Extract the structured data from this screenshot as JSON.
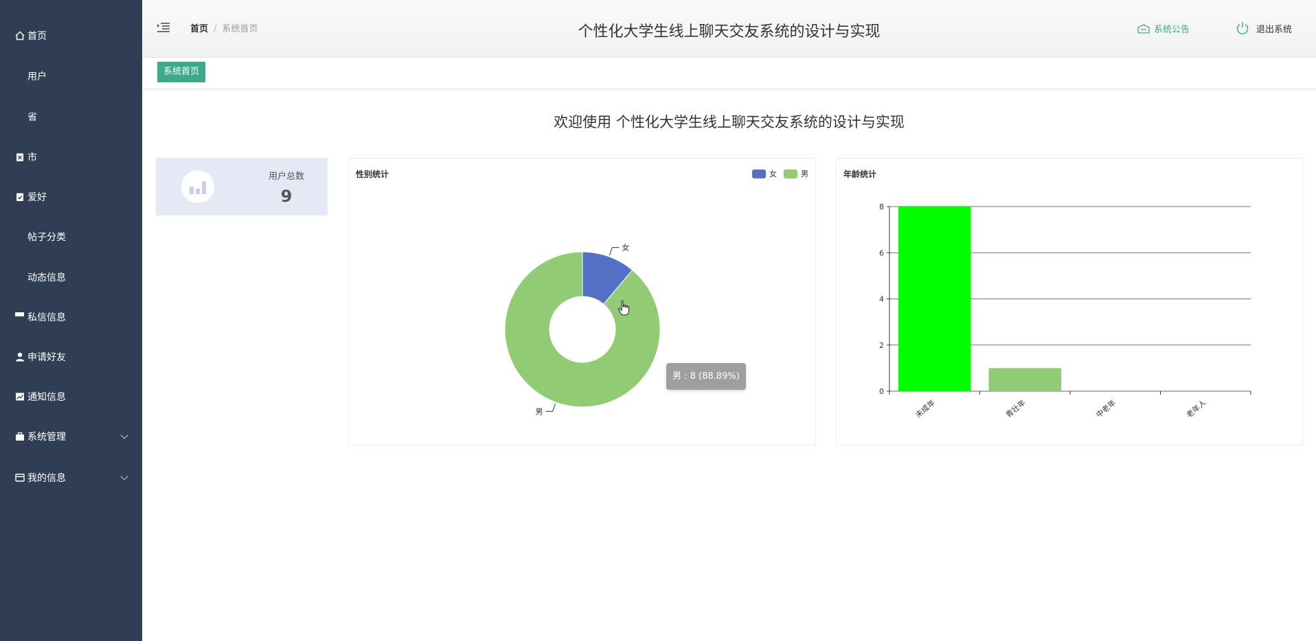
{
  "sidebar": {
    "items": [
      {
        "label": "首页",
        "icon": "home-icon"
      },
      {
        "label": "用户",
        "icon": "grid-icon"
      },
      {
        "label": "省",
        "icon": "grid-icon"
      },
      {
        "label": "市",
        "icon": "clipboard-icon"
      },
      {
        "label": "爱好",
        "icon": "clipboard-check-icon"
      },
      {
        "label": "帖子分类",
        "icon": "grid-icon"
      },
      {
        "label": "动态信息",
        "icon": "grid-icon"
      },
      {
        "label": "私信信息",
        "icon": "list-icon"
      },
      {
        "label": "申请好友",
        "icon": "user-icon"
      },
      {
        "label": "通知信息",
        "icon": "chart-icon"
      },
      {
        "label": "系统管理",
        "icon": "briefcase-icon"
      },
      {
        "label": "我的信息",
        "icon": "card-icon"
      }
    ]
  },
  "header": {
    "title": "个性化大学生线上聊天交友系统的设计与实现",
    "breadcrumb_home": "首页",
    "breadcrumb_sep": "/",
    "breadcrumb_current": "系统首页",
    "notice_label": "系统公告",
    "logout_label": "退出系统"
  },
  "tabs": {
    "active": "系统首页"
  },
  "main": {
    "welcome": "欢迎使用 个性化大学生线上聊天交友系统的设计与实现",
    "stat_label": "用户总数",
    "stat_value": "9"
  },
  "colors": {
    "sidebar_bg": "#2f3e55",
    "accent": "#3daa8a",
    "female": "#5470c6",
    "male": "#91cc75",
    "bar_highlight": "#00ff00"
  },
  "chart_data": [
    {
      "type": "pie",
      "title": "性别统计",
      "donut": true,
      "legend": "top-right",
      "slices": [
        {
          "name": "女",
          "value": 1,
          "color": "#5470c6"
        },
        {
          "name": "男",
          "value": 8,
          "color": "#91cc75"
        }
      ],
      "tooltip": "男 : 8 (88.89%)"
    },
    {
      "type": "bar",
      "title": "年龄统计",
      "categories": [
        "未成年",
        "青壮年",
        "中老年",
        "老年人"
      ],
      "values": [
        8,
        1,
        0,
        0
      ],
      "colors": [
        "#00ff00",
        "#91cc75",
        "#91cc75",
        "#91cc75"
      ],
      "ylim": [
        0,
        8
      ],
      "yticks": [
        "0",
        "2",
        "4",
        "6",
        "8"
      ],
      "grid": true
    }
  ]
}
